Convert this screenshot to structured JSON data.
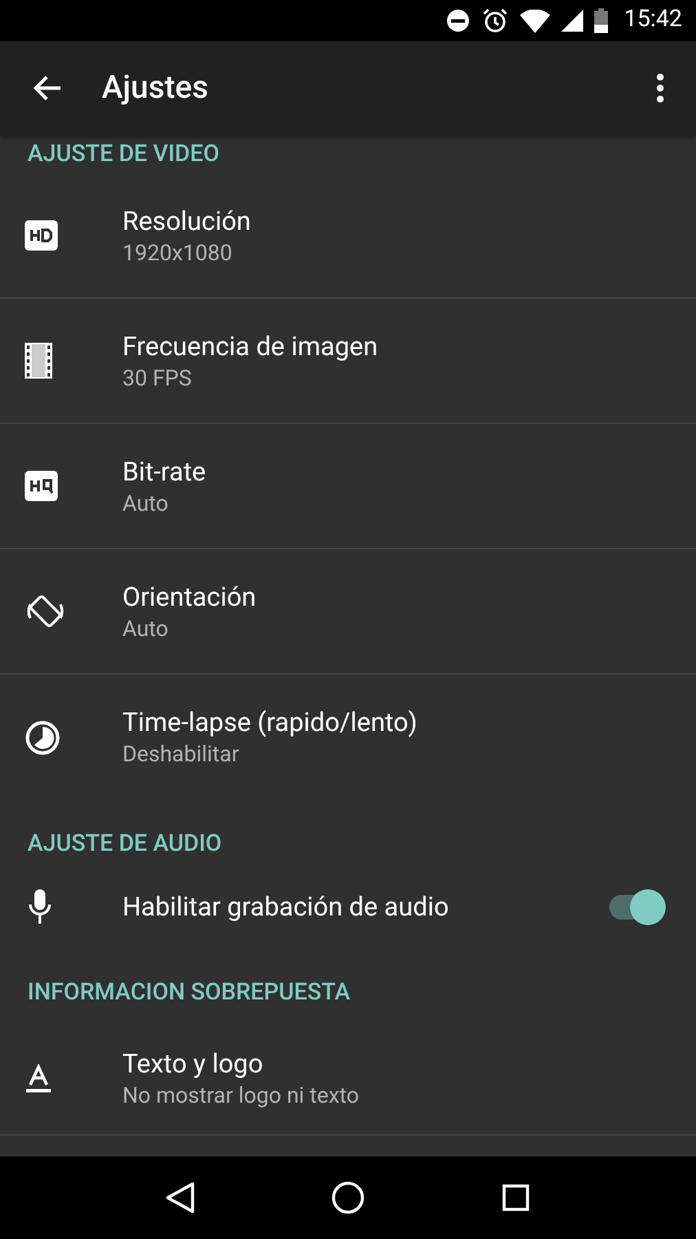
{
  "status_bar": {
    "time": "15:42"
  },
  "toolbar": {
    "title": "Ajustes"
  },
  "sections": [
    {
      "title": "AJUSTE DE VIDEO",
      "items": [
        {
          "kind": "setting",
          "title": "Resolución",
          "summary": "1920x1080"
        },
        {
          "kind": "setting",
          "title": "Frecuencia de imagen",
          "summary": "30 FPS"
        },
        {
          "kind": "setting",
          "title": "Bit-rate",
          "summary": "Auto"
        },
        {
          "kind": "setting",
          "title": "Orientación",
          "summary": "Auto"
        },
        {
          "kind": "setting",
          "title": "Time-lapse (rapido/lento)",
          "summary": "Deshabilitar"
        }
      ]
    },
    {
      "title": "AJUSTE DE AUDIO",
      "items": [
        {
          "kind": "switch",
          "title": "Habilitar grabación de audio",
          "on": true
        }
      ]
    },
    {
      "title": "INFORMACION SOBREPUESTA",
      "items": [
        {
          "kind": "setting",
          "title": "Texto y logo",
          "summary": "No mostrar logo ni texto"
        }
      ]
    }
  ]
}
